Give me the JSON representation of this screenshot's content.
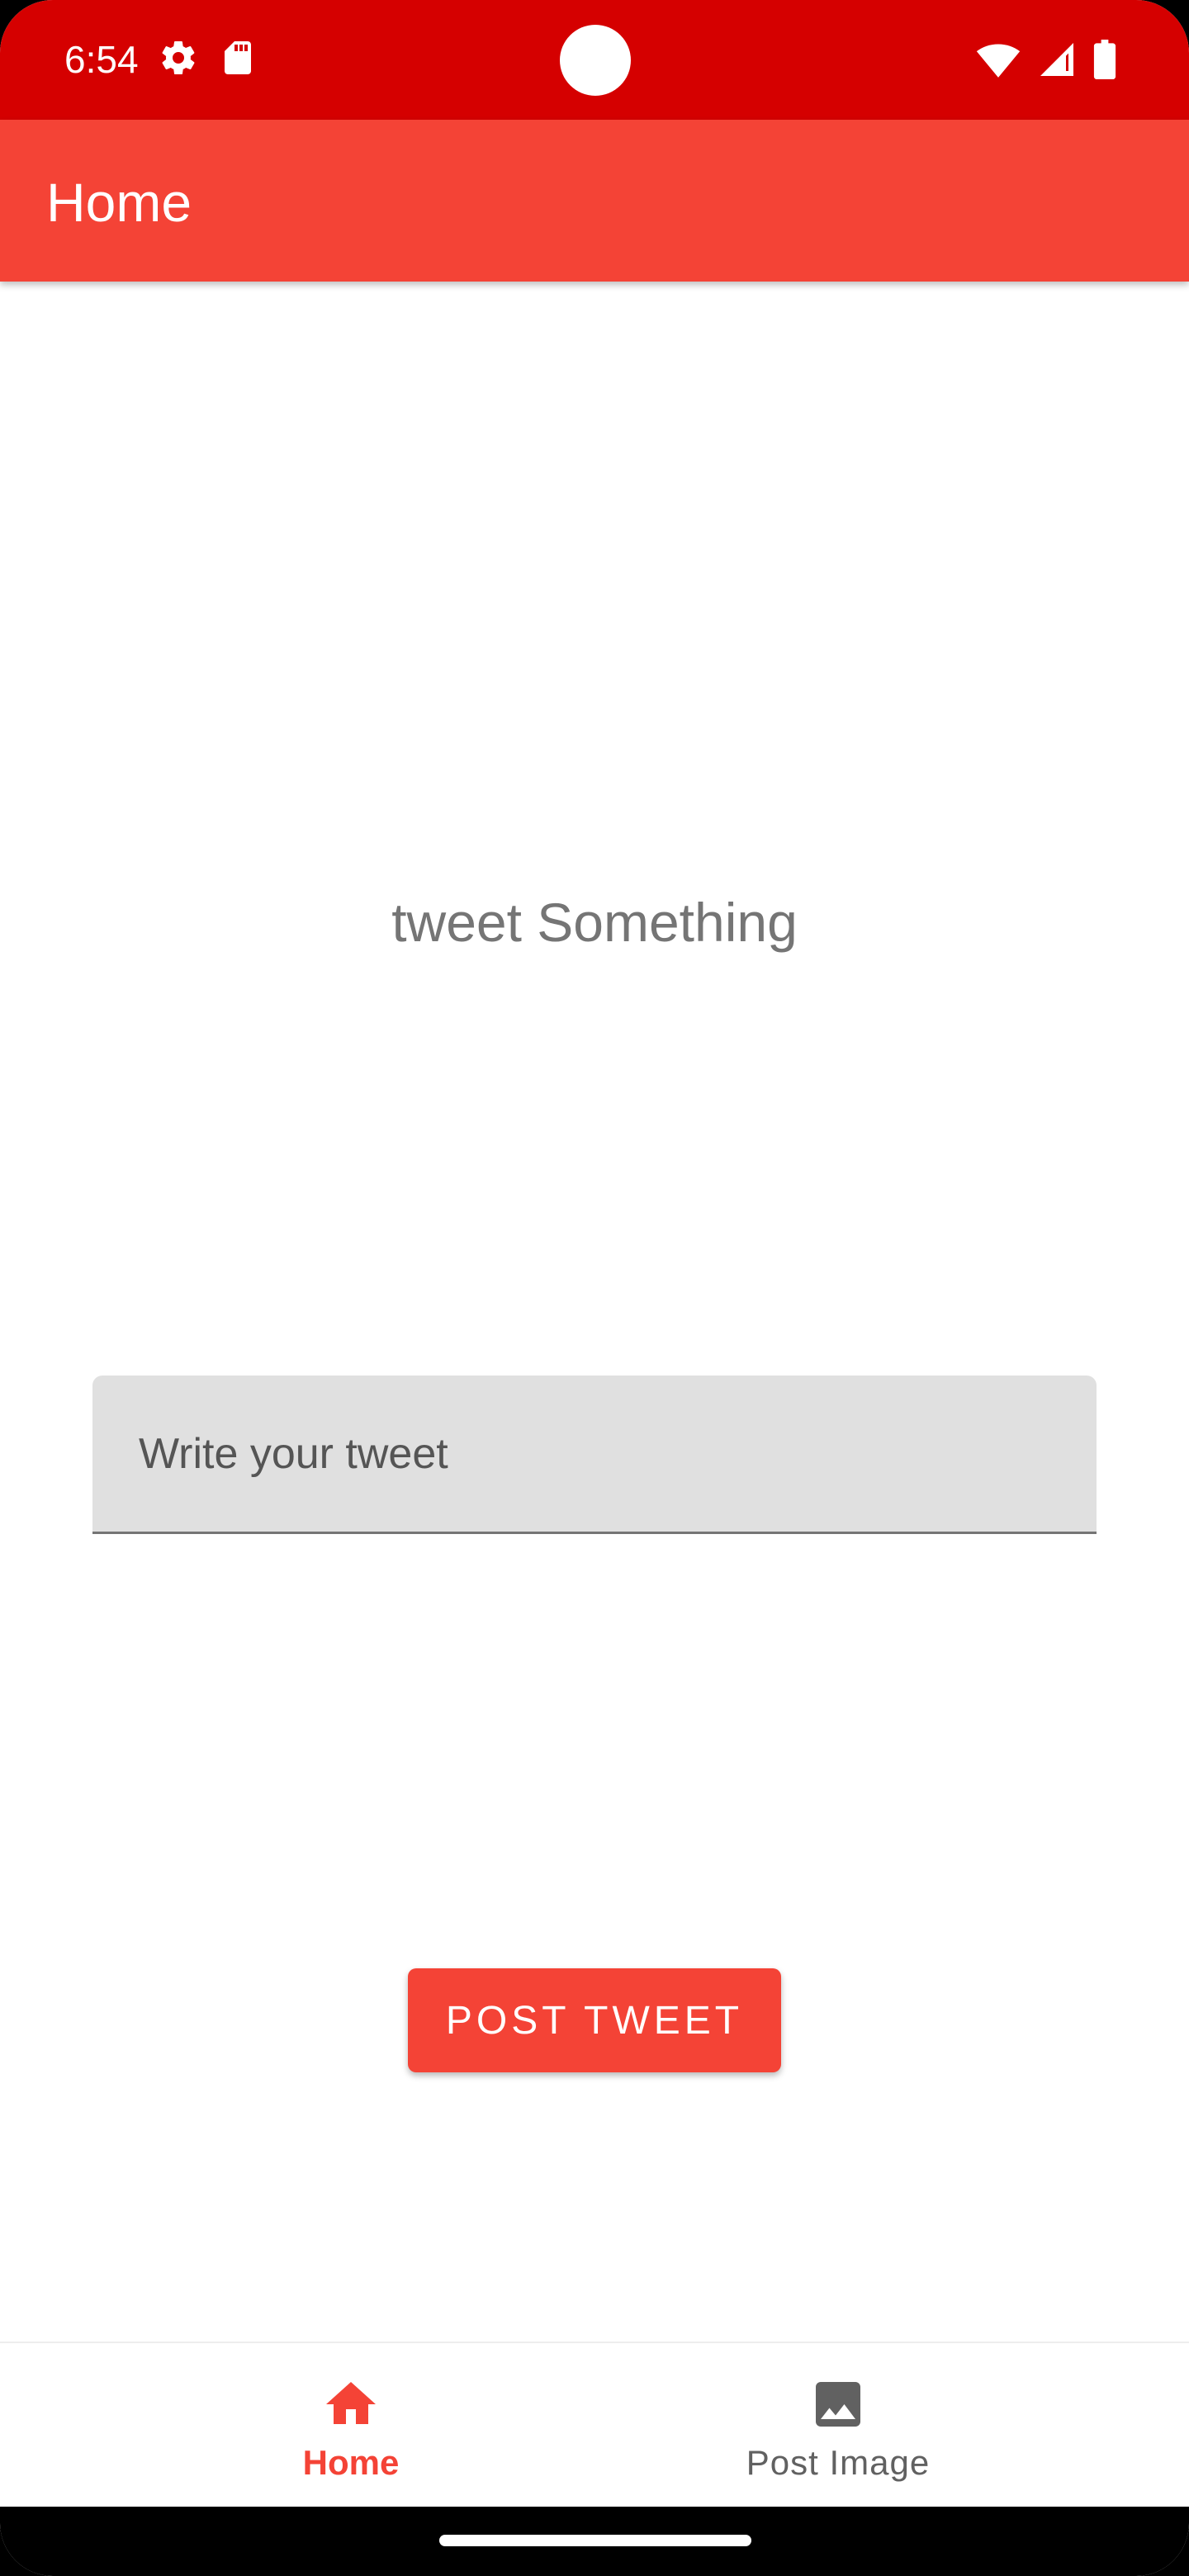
{
  "status_bar": {
    "time": "6:54",
    "left_icons": [
      "settings-gear-icon",
      "sd-card-icon"
    ],
    "right_icons": [
      "wifi-icon",
      "cell-signal-icon",
      "battery-icon"
    ],
    "background_color": "#d50000"
  },
  "app_bar": {
    "title": "Home",
    "background_color": "#f44336"
  },
  "main": {
    "headline": "tweet Something",
    "tweet_input": {
      "placeholder": "Write your tweet",
      "value": ""
    },
    "post_button_label": "POST TWEET"
  },
  "bottom_nav": {
    "items": [
      {
        "label": "Home",
        "icon": "home-icon",
        "active": true
      },
      {
        "label": "Post Image",
        "icon": "image-icon",
        "active": false
      }
    ],
    "active_color": "#f44336",
    "inactive_color": "#616161"
  }
}
